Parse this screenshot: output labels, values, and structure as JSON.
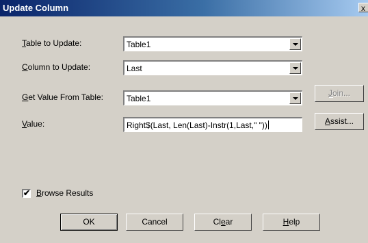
{
  "window": {
    "title": "Update Column",
    "close_glyph": "x"
  },
  "form": {
    "table_label": {
      "key": "T",
      "rest": "able to Update:"
    },
    "table_value": "Table1",
    "column_label": {
      "key": "C",
      "rest": "olumn to Update:"
    },
    "column_value": "Last",
    "get_value_label": {
      "key": "G",
      "rest": "et Value From Table:"
    },
    "get_value_value": "Table1",
    "value_label": {
      "key": "V",
      "rest": "alue:"
    },
    "value_text": "Right$(Last, Len(Last)-Instr(1,Last,\" \"))",
    "join_button": {
      "key": "J",
      "rest": "oin..."
    },
    "assist_button": {
      "key": "A",
      "rest": "ssist..."
    },
    "browse_results": {
      "checked": true,
      "check_glyph": "✔",
      "key": "B",
      "rest": "rowse Results"
    }
  },
  "buttons": {
    "ok": "OK",
    "cancel": "Cancel",
    "clear": {
      "pre": "Cl",
      "key": "e",
      "post": "ar"
    },
    "help": {
      "key": "H",
      "rest": "elp"
    }
  }
}
